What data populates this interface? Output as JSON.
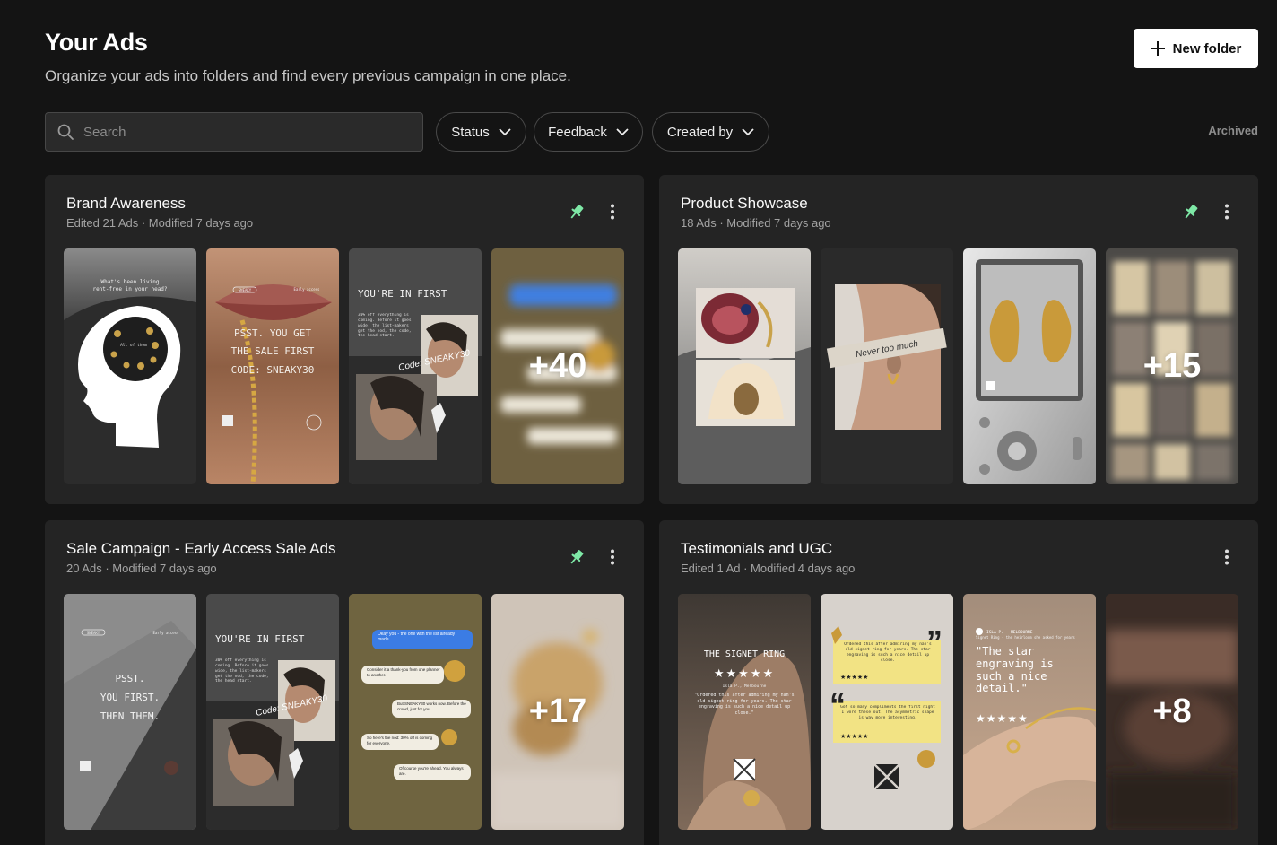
{
  "page": {
    "title": "Your Ads",
    "subtitle": "Organize your ads into folders and find every previous campaign in one place.",
    "new_folder_label": "New folder"
  },
  "search": {
    "placeholder": "Search",
    "value": ""
  },
  "filters": [
    {
      "label": "Status"
    },
    {
      "label": "Feedback"
    },
    {
      "label": "Created by"
    }
  ],
  "archived_label": "Archived",
  "accent_color": "#7ee8a6",
  "folders": [
    {
      "title": "Brand Awareness",
      "meta": "Edited 21 Ads · Modified 7 days ago",
      "pinned": true,
      "more_count": "+40",
      "ads": {
        "a1_top": "What's been living",
        "a1_top2": "rent-free in your head?",
        "a1_inner": "All of them",
        "a2_tag": "SNEAKY",
        "a2_tag2": "Early access",
        "a2_line1": "PSST. YOU GET",
        "a2_line2": "THE SALE FIRST",
        "a2_line3": "CODE: SNEAKY30",
        "a3_title": "YOU'RE IN FIRST",
        "a3_body": "30% off everything is coming. Before it goes wide, the list-makers get the nod, the code, the head start.",
        "a3_script": "Code: SNEAKY30"
      }
    },
    {
      "title": "Product Showcase",
      "meta": "18 Ads · Modified 7 days ago",
      "pinned": true,
      "more_count": "+15",
      "ads": {
        "b2_tape": "Never too much"
      }
    },
    {
      "title": "Sale Campaign - Early Access Sale Ads",
      "meta": "20 Ads · Modified 7 days ago",
      "pinned": true,
      "more_count": "+17",
      "ads": {
        "c1_tag": "SNEAKY",
        "c1_tag2": "Early access",
        "c1_line1": "PSST.",
        "c1_line2": "YOU FIRST.",
        "c1_line3": "THEN THEM.",
        "c2_title": "YOU'RE IN FIRST",
        "c2_body": "30% off everything is coming. Before it goes wide, the list-makers get the nod, the code, the head start.",
        "c2_script": "Code: SNEAKY30",
        "c3_b1": "Okay you - the one with the list already made...",
        "c3_b2": "Consider it a thank-you from one planner to another.",
        "c3_b3": "But SNEAKY30 works now. Before the crowd, just for you.",
        "c3_b4": "So here's the nod: 30% off is coming for everyone.",
        "c3_b5": "Of course you're ahead. You always are."
      }
    },
    {
      "title": "Testimonials and UGC",
      "meta": "Edited 1 Ad · Modified 4 days ago",
      "pinned": false,
      "more_count": "+8",
      "ads": {
        "d1_title": "THE SIGNET RING",
        "d1_stars": "★★★★★",
        "d1_author": "Isla P., Melbourne",
        "d1_quote": "\"Ordered this after admiring my nan's old signet ring for years. The star engraving is such a nice detail up close.\"",
        "d2_q1": "Ordered this after admiring my nan's old signet ring for years. The star engraving is such a nice detail up close.",
        "d2_q2": "Got so many compliments the first night I wore these out. The asymmetric shape is way more interesting.",
        "d2_stars": "★★★★★",
        "d3_author": "ISLA P. · MELBOURNE",
        "d3_sub": "Signet Ring - the heirloom she asked for years",
        "d3_quote": "\"The star engraving is such a nice detail.\"",
        "d3_stars": "★★★★★"
      }
    }
  ]
}
